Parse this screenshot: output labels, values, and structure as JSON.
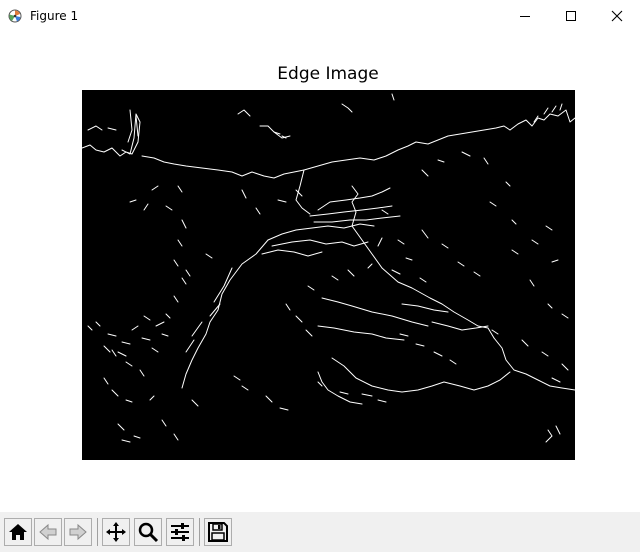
{
  "window": {
    "title": "Figure 1",
    "buttons": {
      "minimize": "minimize",
      "maximize": "maximize",
      "close": "close"
    }
  },
  "figure": {
    "title": "Edge Image",
    "image_description": "Canny edge-detected image: white edge lines on black background"
  },
  "toolbar": {
    "items": [
      {
        "name": "home",
        "icon": "home-icon"
      },
      {
        "name": "back",
        "icon": "back-arrow-icon"
      },
      {
        "name": "forward",
        "icon": "forward-arrow-icon"
      },
      {
        "name": "pan",
        "icon": "move-icon"
      },
      {
        "name": "zoom",
        "icon": "magnifier-icon"
      },
      {
        "name": "configure-subplots",
        "icon": "sliders-icon"
      },
      {
        "name": "save",
        "icon": "floppy-disk-icon"
      }
    ]
  },
  "colors": {
    "canvas_bg": "#000000",
    "edge": "#ffffff",
    "toolbar_bg": "#f0f0f0"
  }
}
